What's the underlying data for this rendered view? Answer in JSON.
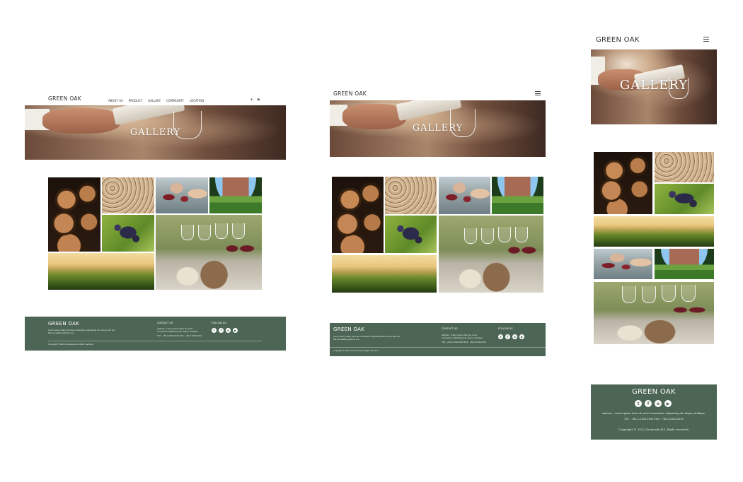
{
  "brand": "GREEN OAK",
  "hero_title": "GALLERY",
  "nav": {
    "items": [
      "ABOUT US",
      "PRODUCT",
      "GALLERY",
      "COMMUNITY",
      "LOCATION"
    ],
    "user_icon": "user-icon",
    "youtube_icon": "youtube-icon"
  },
  "footer": {
    "brand": "GREEN OAK",
    "desc_line1": "Lorem ipsum dolor, sit amet consectetur adipisicing elit. Aut qui sint nisi",
    "desc_line2": "We are waiting right for you.",
    "contact_heading": "CONTACT US",
    "contact_address1": "address : Lorem ipsum dolor sit, amet",
    "contact_address2": "consectetur adipisicing elit. Atque, similique.",
    "contact_phone": "TEL : +82-2-2100-2100 FAX : +82-2-2100-2101",
    "follow_heading": "FOLLOW US",
    "social": [
      "twitter-icon",
      "facebook-icon",
      "instagram-icon",
      "youtube-icon"
    ],
    "copyright": "Copyright © 2022 Greenoak ALL Right reserved",
    "mobile_address": "address : Lorem ipsum dolor sit, amet consectetur adipisicing elit. Atque, similique.",
    "mobile_phone": "TEL : +82-2-2100-2100 FAX : +82-2-2100-2101",
    "mobile_copyright": "Copyright © 2022 Greenoak ALL Right reserved."
  },
  "colors": {
    "footer_bg": "#4c6554",
    "page_bg": "#ffffff"
  }
}
